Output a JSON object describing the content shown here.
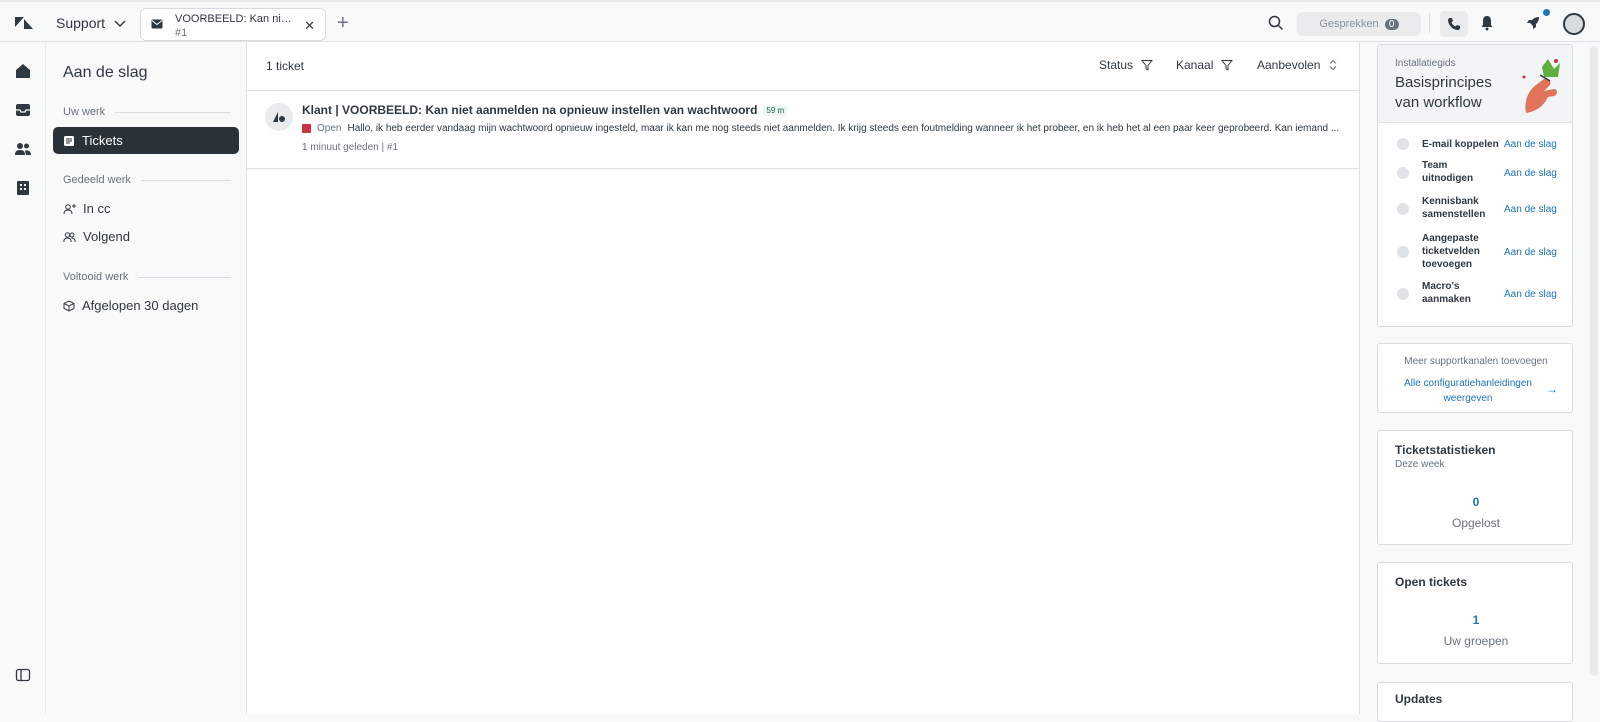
{
  "header": {
    "product": "Support",
    "tab": {
      "title": "VOORBEELD: Kan niet a...",
      "subtitle": "#1"
    },
    "conversations": {
      "label": "Gesprekken",
      "count": "0"
    }
  },
  "sidebar": {
    "title": "Aan de slag",
    "sections": [
      {
        "label": "Uw werk",
        "items": [
          {
            "label": "Tickets",
            "active": true
          }
        ]
      },
      {
        "label": "Gedeeld werk",
        "items": [
          {
            "label": "In cc"
          },
          {
            "label": "Volgend"
          }
        ]
      },
      {
        "label": "Voltooid werk",
        "items": [
          {
            "label": "Afgelopen 30 dagen"
          }
        ]
      }
    ]
  },
  "main": {
    "count": "1 ticket",
    "filters": {
      "status": "Status",
      "channel": "Kanaal",
      "sort": "Aanbevolen"
    },
    "tickets": [
      {
        "subject": "Klant | VOORBEELD: Kan niet aanmelden na opnieuw instellen van wachtwoord",
        "sla": "59 m",
        "status": "Open",
        "preview": "Hallo, ik heb eerder vandaag mijn wachtwoord opnieuw ingesteld, maar ik kan me nog steeds niet aanmelden. Ik krijg steeds een foutmelding wanneer ik het probeer, en ik heb het al een paar keer geprobeerd. Kan iemand ...",
        "meta": "1 minuut geleden | #1"
      }
    ]
  },
  "right_panel": {
    "guide": {
      "label": "Installatiegids",
      "title": "Basisprincipes van workflow",
      "steps": [
        {
          "label": "E-mail koppelen",
          "action": "Aan de slag"
        },
        {
          "label": "Team uitnodigen",
          "action": "Aan de slag"
        },
        {
          "label": "Kennisbank samenstellen",
          "action": "Aan de slag"
        },
        {
          "label": "Aangepaste ticketvelden toevoegen",
          "action": "Aan de slag"
        },
        {
          "label": "Macro's aanmaken",
          "action": "Aan de slag"
        }
      ]
    },
    "more_channels": {
      "title": "Meer supportkanalen toevoegen",
      "link": "Alle configuratiehanleidingen weergeven"
    },
    "stats": {
      "title": "Ticketstatistieken",
      "subtitle": "Deze week",
      "value": "0",
      "label": "Opgelost"
    },
    "open_tickets": {
      "title": "Open tickets",
      "value": "1",
      "label": "Uw groepen"
    },
    "updates": {
      "title": "Updates"
    }
  }
}
